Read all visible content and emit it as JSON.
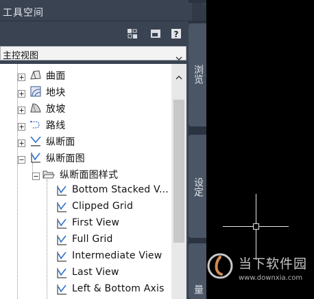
{
  "palette": {
    "title": "工具空间",
    "toolbar": {
      "icons": [
        "toggle-display-icon",
        "palette-options-icon",
        "help-icon"
      ]
    },
    "view_select": {
      "selected": "主控视图"
    },
    "tree": [
      {
        "label": "曲面",
        "icon": "surface-icon",
        "expanded": false
      },
      {
        "label": "地块",
        "icon": "parcel-icon",
        "expanded": false
      },
      {
        "label": "放坡",
        "icon": "grading-icon",
        "expanded": false
      },
      {
        "label": "路线",
        "icon": "alignment-icon",
        "expanded": false
      },
      {
        "label": "纵断面",
        "icon": "profile-icon",
        "expanded": false
      },
      {
        "label": "纵断面图",
        "icon": "profile-view-icon",
        "expanded": true
      },
      {
        "label": "纵断面图样式",
        "icon": "folder-open-icon",
        "expanded": true
      },
      {
        "label": "Bottom Stacked V...",
        "icon": "style-icon"
      },
      {
        "label": "Clipped Grid",
        "icon": "style-icon"
      },
      {
        "label": "First View",
        "icon": "style-icon"
      },
      {
        "label": "Full Grid",
        "icon": "style-icon"
      },
      {
        "label": "Intermediate View",
        "icon": "style-icon"
      },
      {
        "label": "Last View",
        "icon": "style-icon"
      },
      {
        "label": "Left & Bottom Axis",
        "icon": "style-icon"
      }
    ]
  },
  "side_tabs": [
    "浏览",
    "设定",
    "量"
  ],
  "watermark": {
    "name": "当下软件园",
    "url": "www.downxia.com"
  },
  "colors": {
    "panel": "#3a4352",
    "viewport": "#000000",
    "tree_bg": "#ffffff",
    "tab": "#4a5566"
  }
}
